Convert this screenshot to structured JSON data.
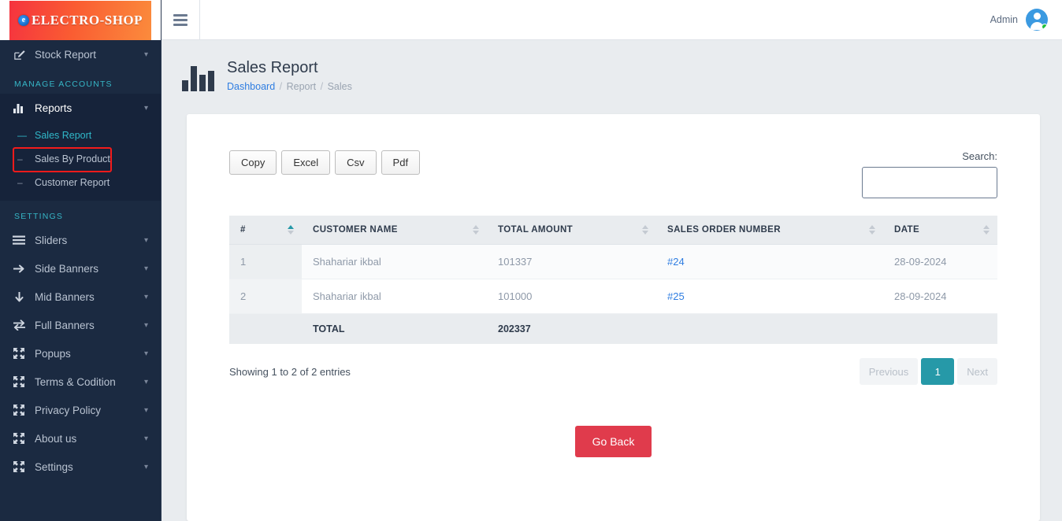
{
  "brand": {
    "name": "ELECTRO-SHOP",
    "mark": "e",
    "gradient_from": "#f5333f",
    "gradient_to": "#fb8b3c"
  },
  "topbar": {
    "menu_toggle": "hamburger-icon",
    "admin_label": "Admin",
    "status": "online"
  },
  "sidebar": {
    "top_items": [
      {
        "label": "Stock Report",
        "icon": "pen-to-square-icon",
        "chevron": "⌄"
      }
    ],
    "sections": [
      {
        "title": "MANAGE ACCOUNTS",
        "items": [
          {
            "label": "Reports",
            "icon": "bar-chart-icon",
            "chevron": "⌄",
            "active": true
          }
        ],
        "submenu": [
          {
            "label": "Sales Report",
            "dash": "—",
            "current": true
          },
          {
            "label": "Sales By Product",
            "dash": "–",
            "current": false
          },
          {
            "label": "Customer Report",
            "dash": "–",
            "current": false
          }
        ]
      },
      {
        "title": "SETTINGS",
        "items": [
          {
            "label": "Sliders",
            "icon": "bars-icon",
            "chevron": "⌄"
          },
          {
            "label": "Side Banners",
            "icon": "arrow-right-icon",
            "chevron": "⌄"
          },
          {
            "label": "Mid Banners",
            "icon": "arrow-down-icon",
            "chevron": "⌄"
          },
          {
            "label": "Full Banners",
            "icon": "exchange-arrows-icon",
            "chevron": "⌄"
          },
          {
            "label": "Popups",
            "icon": "expand-arrows-icon",
            "chevron": "⌄"
          },
          {
            "label": "Terms & Codition",
            "icon": "expand-arrows-icon",
            "chevron": "⌄"
          },
          {
            "label": "Privacy Policy",
            "icon": "expand-arrows-icon",
            "chevron": "⌄"
          },
          {
            "label": "About us",
            "icon": "expand-arrows-icon",
            "chevron": "⌄"
          },
          {
            "label": "Settings",
            "icon": "expand-arrows-icon",
            "chevron": "⌄"
          }
        ],
        "submenu": []
      }
    ],
    "highlight_color": "#f21b1b",
    "accent_color": "#30b8c9"
  },
  "page": {
    "title": "Sales Report",
    "icon": "bar-chart-icon",
    "breadcrumb": {
      "link": "Dashboard",
      "sep1": "/",
      "mid": "Report",
      "sep2": "/",
      "last": "Sales"
    }
  },
  "toolbar": {
    "buttons": [
      {
        "label": "Copy"
      },
      {
        "label": "Excel"
      },
      {
        "label": "Csv"
      },
      {
        "label": "Pdf"
      }
    ]
  },
  "search": {
    "label": "Search:",
    "value": "",
    "placeholder": ""
  },
  "table": {
    "columns": [
      {
        "label": "#",
        "sorted": true,
        "dir": "asc"
      },
      {
        "label": "CUSTOMER NAME",
        "sorted": false
      },
      {
        "label": "TOTAL AMOUNT",
        "sorted": false
      },
      {
        "label": "SALES ORDER NUMBER",
        "sorted": false
      },
      {
        "label": "DATE",
        "sorted": false
      }
    ],
    "rows": [
      {
        "index": "1",
        "customer": "Shahariar ikbal",
        "amount": "101337",
        "order": "#24",
        "date": "28-09-2024"
      },
      {
        "index": "2",
        "customer": "Shahariar ikbal",
        "amount": "101000",
        "order": "#25",
        "date": "28-09-2024"
      }
    ],
    "footer": {
      "label": "TOTAL",
      "amount": "202337"
    }
  },
  "footer": {
    "info": "Showing 1 to 2 of 2 entries",
    "pagination": {
      "previous": "Previous",
      "pages": [
        "1"
      ],
      "next": "Next",
      "active_page": "1",
      "active_color": "#2699a8"
    },
    "go_back": "Go Back",
    "go_back_color": "#e03b4c"
  }
}
